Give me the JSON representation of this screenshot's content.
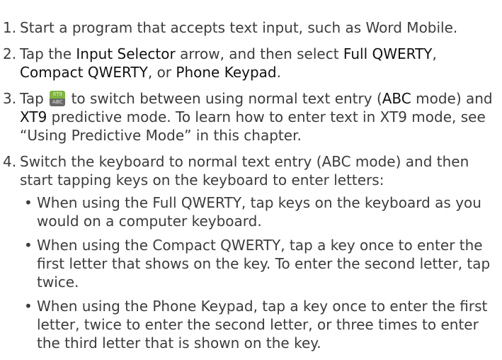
{
  "steps": [
    {
      "number": "1.",
      "text": "Start a program that accepts text input, such as Word Mobile."
    },
    {
      "number": "2.",
      "pre": "Tap the ",
      "input_selector": "Input Selector",
      "mid1": " arrow, and then select ",
      "full_qwerty": "Full QWERTY",
      "comma": ",",
      "compact_qwerty": "Compact QWERTY",
      "mid2": ", or ",
      "phone_keypad": "Phone Keypad",
      "end": "."
    },
    {
      "number": "3.",
      "pre": "Tap ",
      "icon": "xt9-abc-toggle-icon",
      "mid1": " to switch between using normal text entry (",
      "abc": "ABC",
      "mid2": " mode) and ",
      "xt9": "XT9",
      "rest": " predictive mode. To learn how to enter text in XT9 mode, see “Using Predictive Mode” in this chapter."
    },
    {
      "number": "4.",
      "text": "Switch the keyboard to normal text entry (ABC mode) and then start tapping keys on the keyboard to enter letters:",
      "bullets": [
        "When using the Full QWERTY, tap keys on the keyboard as you would on a computer keyboard.",
        "When using the Compact QWERTY, tap a key once to enter the first letter that shows on the key. To enter the second letter, tap twice.",
        "When using the Phone Keypad, tap a key once to enter the first letter, twice to enter the second letter, or three times to enter the third letter that is shown on the key."
      ]
    }
  ],
  "icon_labels": {
    "top": "XT9",
    "bottom": "ABC"
  },
  "colors": {
    "body_text": "#3c3c3c",
    "icon_green": "#7fb541",
    "icon_gray": "#6a6a6a"
  }
}
